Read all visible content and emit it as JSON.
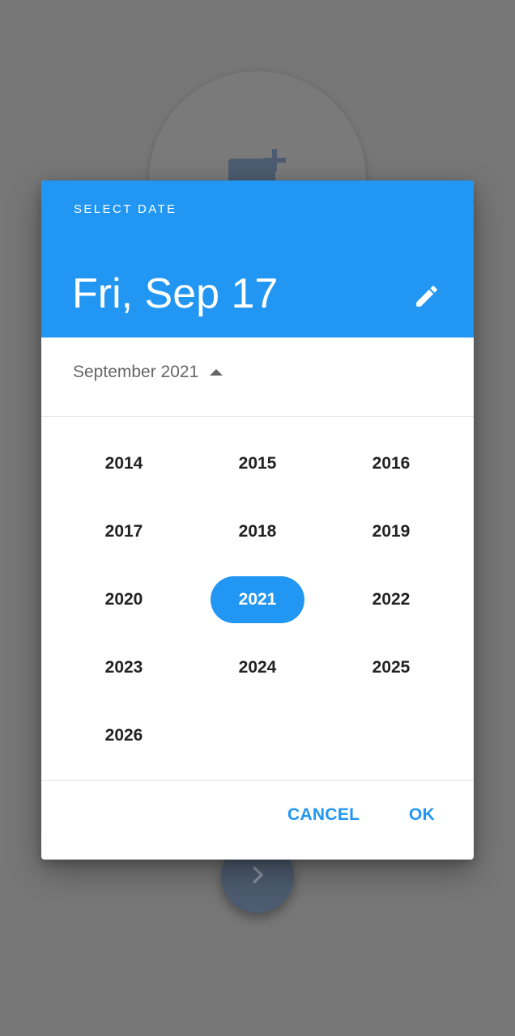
{
  "dialog": {
    "header_label": "SELECT DATE",
    "selected_date": "Fri, Sep 17",
    "month_label": "September 2021",
    "years": [
      "2014",
      "2015",
      "2016",
      "2017",
      "2018",
      "2019",
      "2020",
      "2021",
      "2022",
      "2023",
      "2024",
      "2025",
      "2026"
    ],
    "selected_year": "2021",
    "cancel_label": "CANCEL",
    "ok_label": "OK"
  },
  "colors": {
    "accent": "#2196f3",
    "scrim": "#777777"
  },
  "icons": {
    "edit": "pencil-icon",
    "month_toggle": "caret-up-icon",
    "background_add": "add-to-queue-icon",
    "background_next": "chevron-right-icon"
  }
}
